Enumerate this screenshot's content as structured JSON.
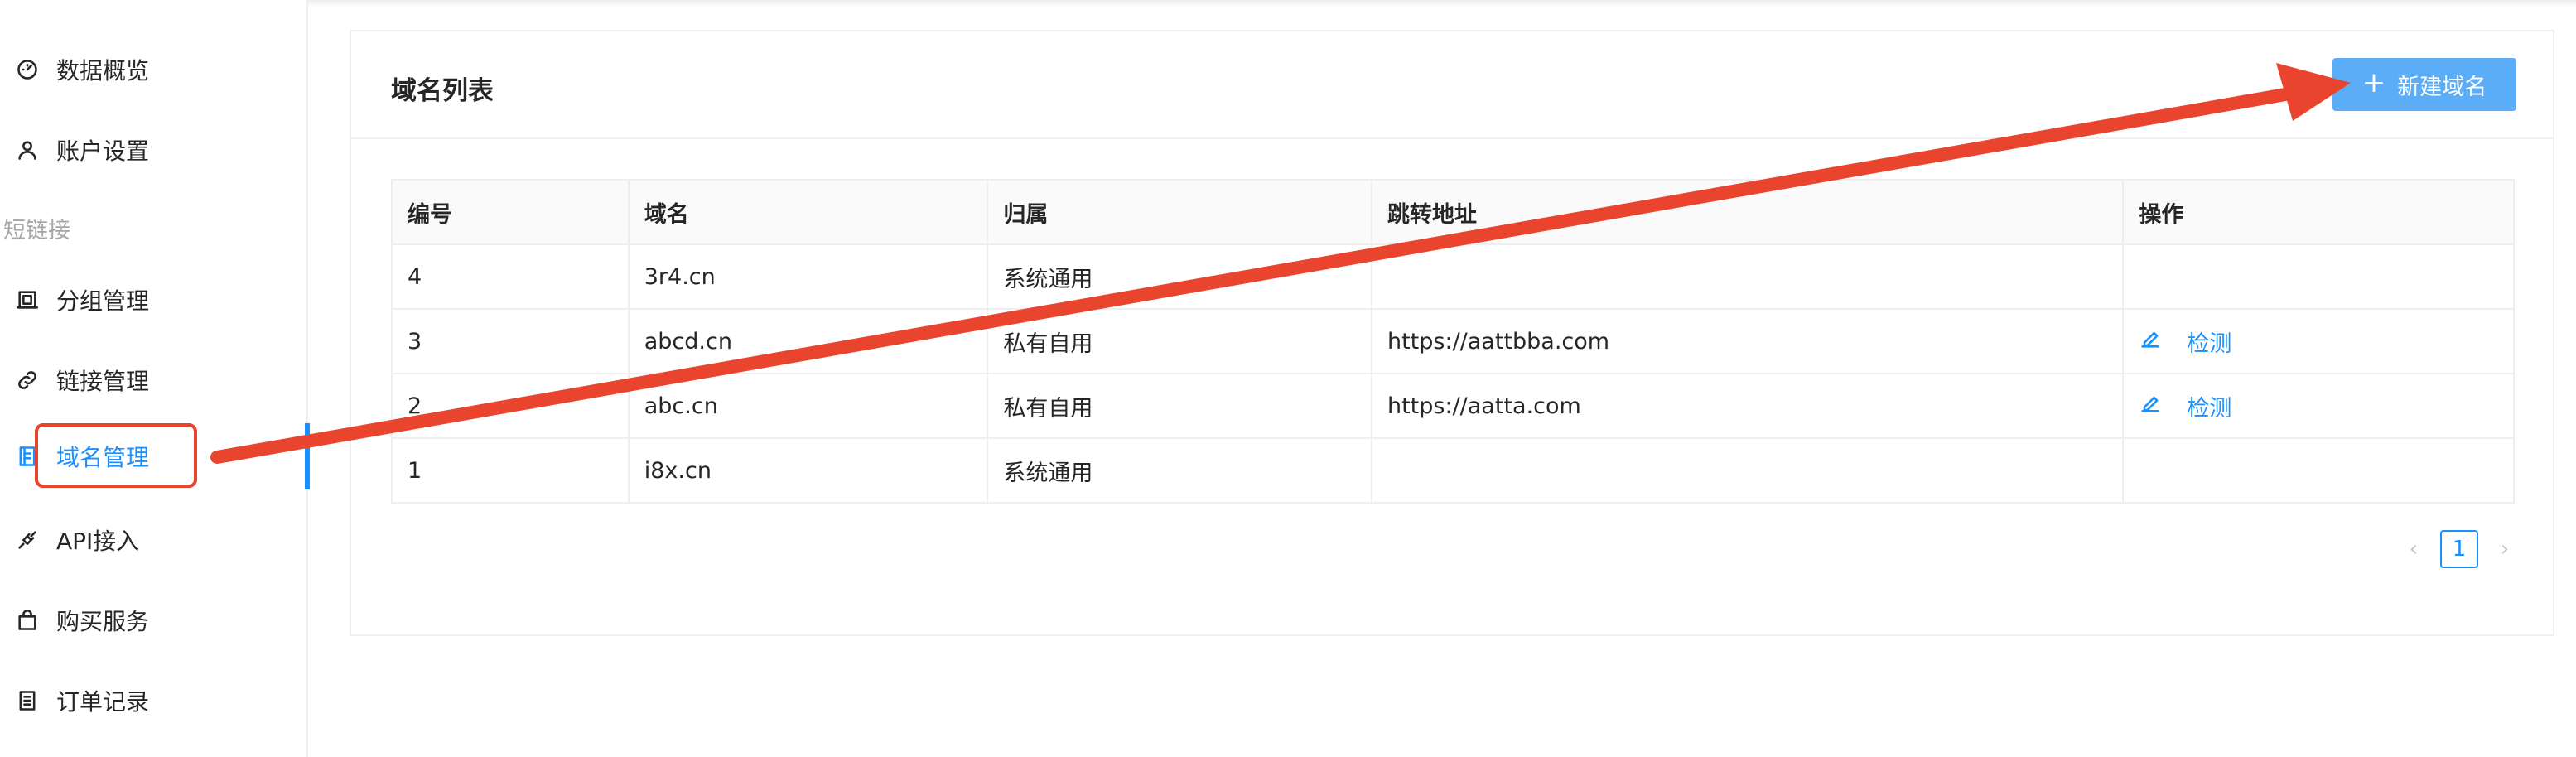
{
  "sidebar": {
    "items": [
      {
        "label": "数据概览",
        "icon": "dashboard-icon"
      },
      {
        "label": "账户设置",
        "icon": "user-icon"
      }
    ],
    "group_title": "短链接",
    "group_items": [
      {
        "label": "分组管理",
        "icon": "group-icon"
      },
      {
        "label": "链接管理",
        "icon": "link-icon"
      },
      {
        "label": "域名管理",
        "icon": "domain-icon",
        "active": true
      },
      {
        "label": "API接入",
        "icon": "api-icon"
      },
      {
        "label": "购买服务",
        "icon": "shopping-bag-icon"
      },
      {
        "label": "订单记录",
        "icon": "order-icon"
      }
    ]
  },
  "card": {
    "title": "域名列表",
    "new_button_label": "新建域名"
  },
  "table": {
    "columns": [
      "编号",
      "域名",
      "归属",
      "跳转地址",
      "操作"
    ],
    "rows": [
      {
        "id": "4",
        "domain": "3r4.cn",
        "owner": "系统通用",
        "redirect": "",
        "action": ""
      },
      {
        "id": "3",
        "domain": "abcd.cn",
        "owner": "私有自用",
        "redirect": "https://aattbba.com",
        "action": "检测"
      },
      {
        "id": "2",
        "domain": "abc.cn",
        "owner": "私有自用",
        "redirect": "https://aatta.com",
        "action": "检测"
      },
      {
        "id": "1",
        "domain": "i8x.cn",
        "owner": "系统通用",
        "redirect": "",
        "action": ""
      }
    ]
  },
  "pagination": {
    "current_page": "1",
    "prev_icon": "chevron-left-icon",
    "next_icon": "chevron-right-icon"
  },
  "colors": {
    "accent": "#1890ff",
    "button": "#5cadf7",
    "annotation": "#e8442e"
  }
}
